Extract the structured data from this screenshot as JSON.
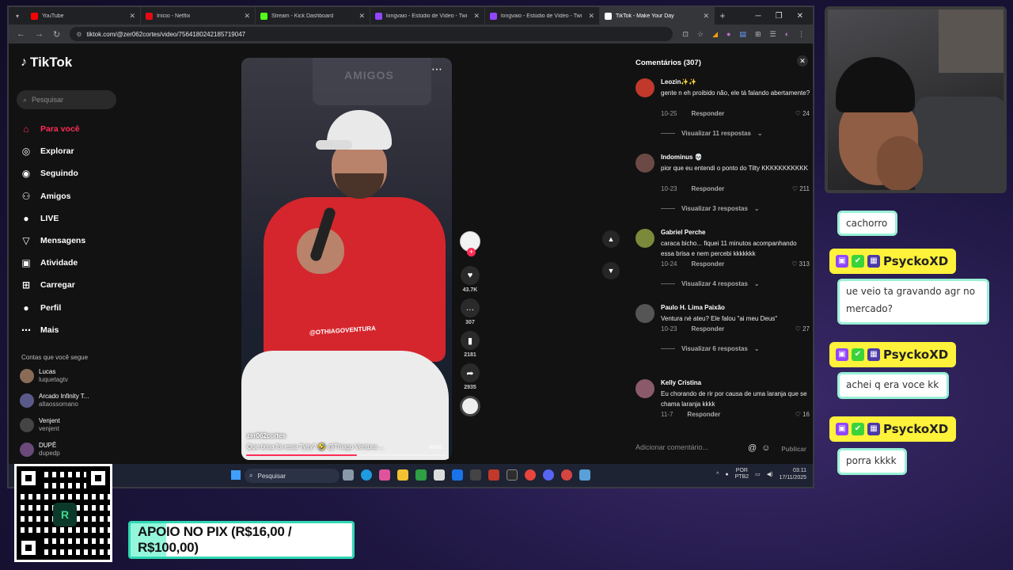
{
  "browser": {
    "tabs": [
      {
        "label": "YouTube",
        "color": "#ff0000",
        "active": false
      },
      {
        "label": "Início - Netflix",
        "color": "#e50914",
        "active": false
      },
      {
        "label": "Stream - Kick Dashboard",
        "color": "#53fc18",
        "active": false
      },
      {
        "label": "longvaio - Estúdio de Vídeo - Twi",
        "color": "#9146ff",
        "active": false
      },
      {
        "label": "longvaio - Estúdio de Vídeo - Twi",
        "color": "#9146ff",
        "active": false
      },
      {
        "label": "TikTok - Make Your Day",
        "color": "#ffffff",
        "active": true
      }
    ],
    "url": "tiktok.com/@zer062cortes/video/7564180242185719047"
  },
  "tiktok": {
    "logo": "TikTok",
    "search_placeholder": "Pesquisar",
    "menu": [
      {
        "label": "Para você",
        "icon": "home-icon",
        "glyph": "⌂",
        "active": true
      },
      {
        "label": "Explorar",
        "icon": "compass-icon",
        "glyph": "◎",
        "active": false
      },
      {
        "label": "Seguindo",
        "icon": "following-icon",
        "glyph": "◉",
        "active": false
      },
      {
        "label": "Amigos",
        "icon": "friends-icon",
        "glyph": "⚇",
        "active": false
      },
      {
        "label": "LIVE",
        "icon": "live-icon",
        "glyph": "●",
        "active": false
      },
      {
        "label": "Mensagens",
        "icon": "messages-icon",
        "glyph": "▽",
        "active": false
      },
      {
        "label": "Atividade",
        "icon": "activity-icon",
        "glyph": "▣",
        "active": false
      },
      {
        "label": "Carregar",
        "icon": "upload-icon",
        "glyph": "⊞",
        "active": false
      },
      {
        "label": "Perfil",
        "icon": "profile-icon",
        "glyph": "●",
        "active": false
      },
      {
        "label": "Mais",
        "icon": "more-icon",
        "glyph": "⋯",
        "active": false
      }
    ],
    "following_title": "Contas que você segue",
    "following": [
      {
        "name": "Lucas",
        "user": "luquetagtv"
      },
      {
        "name": "Arcado Infinity T...",
        "user": "altaossomano"
      },
      {
        "name": "Venjent",
        "user": "venjent"
      },
      {
        "name": "DUPÊ",
        "user": "dupedp"
      }
    ],
    "video": {
      "author": "zer062cortes",
      "caption": "Que brisa foi essa Tylty? 🤣 @Thiago Ventura ...",
      "more": "mais",
      "shirt_text": "@OTHIAGOVENTURA",
      "stage_text": "AMIGOS",
      "progress": 0.55
    },
    "actions": {
      "likes": "43.7K",
      "comments": "307",
      "saves": "2181",
      "shares": "2935"
    },
    "comments": {
      "title": "Comentários (307)",
      "reply_label": "Responder",
      "items": [
        {
          "user": "Leozin✨✨",
          "text": "gente n eh proibido não, ele tá falando abertamente?",
          "date": "10-25",
          "likes": "24",
          "replies": "Visualizar 11 respostas",
          "avatar": "#c0392b"
        },
        {
          "user": "Indominus 💀",
          "text": "pior que eu entendi o ponto do Tilty KKKKKKKKKKK",
          "date": "10-23",
          "likes": "211",
          "replies": "Visualizar 3 respostas",
          "avatar": "#6b4a45"
        },
        {
          "user": "Gabriel Perche",
          "text": "caraca bicho... fiquei 11 minutos acompanhando essa brisa e nem percebi kkkkkkk",
          "date": "10-24",
          "likes": "313",
          "replies": "Visualizar 4 respostas",
          "avatar": "#7a8a3a"
        },
        {
          "user": "Paulo H. Lima Paixão",
          "text": "Ventura né ateu? Ele falou \"ai meu Deus\"",
          "date": "10-23",
          "likes": "27",
          "replies": "Visualizar 6 respostas",
          "avatar": "#555555"
        },
        {
          "user": "Kelly Cristina",
          "text": "Eu chorando de rir por causa de uma laranja que se chama laranja kkkk",
          "date": "11-7",
          "likes": "16",
          "replies": "",
          "avatar": "#8a5a6a"
        }
      ],
      "input_placeholder": "Adicionar comentário...",
      "post_label": "Publicar"
    }
  },
  "taskbar": {
    "search": "Pesquisar",
    "lang_top": "POR",
    "lang_bottom": "PTB2",
    "time": "03:11",
    "date": "17/11/2025"
  },
  "chat": {
    "messages": [
      {
        "type": "text",
        "text": "cachorro"
      },
      {
        "type": "name",
        "text": "PsyckoXD"
      },
      {
        "type": "text",
        "text": "ue veio ta gravando agr no mercado?"
      },
      {
        "type": "name",
        "text": "PsyckoXD"
      },
      {
        "type": "text",
        "text": "achei q era voce kk"
      },
      {
        "type": "name",
        "text": "PsyckoXD"
      },
      {
        "type": "text",
        "text": "porra kkkk"
      }
    ]
  },
  "overlay": {
    "donation": "APOIO NO PIX (R$16,00 / R$100,00)",
    "donation_progress": 0.16,
    "qr_center": "R"
  }
}
